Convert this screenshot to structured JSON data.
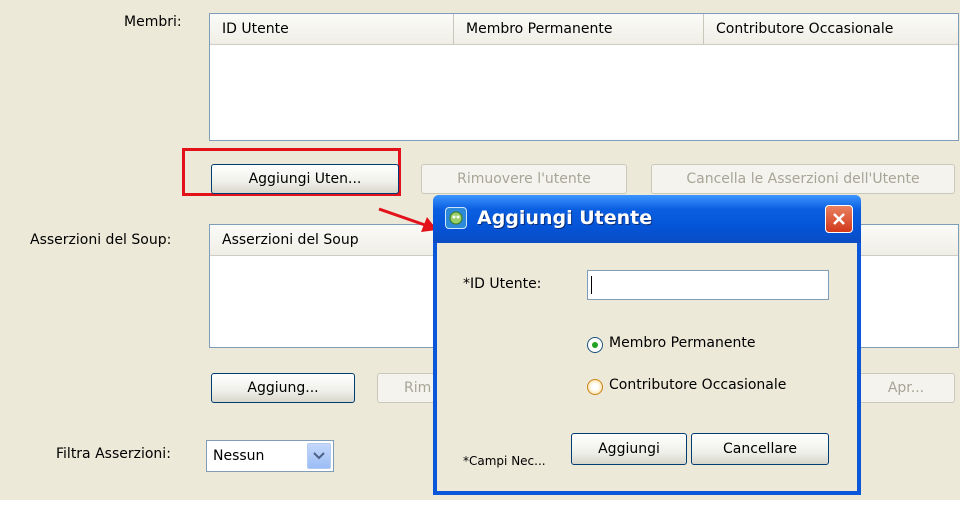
{
  "members": {
    "label": "Membri:",
    "columns": [
      "ID Utente",
      "Membro Permanente",
      "Contributore Occasionale"
    ],
    "rows": []
  },
  "member_buttons": {
    "add": "Aggiungi Uten...",
    "remove": "Rimuovere l'utente",
    "clear_assertions": "Cancella le Asserzioni dell'Utente"
  },
  "assertions": {
    "label": "Asserzioni del Soup:",
    "column": "Asserzioni del Soup",
    "rows": []
  },
  "assertion_buttons": {
    "add": "Aggiung...",
    "remove_partial": "Rim",
    "open": "Apr..."
  },
  "filter": {
    "label": "Filtra Asserzioni:",
    "value": "Nessun"
  },
  "dialog": {
    "title": "Aggiungi Utente",
    "user_id_label": "*ID Utente:",
    "user_id_value": "",
    "options": [
      {
        "label": "Membro Permanente",
        "checked": true
      },
      {
        "label": "Contributore Occasionale",
        "checked": false
      }
    ],
    "required_note": "*Campi Nec...",
    "add_button": "Aggiungi",
    "cancel_button": "Cancellare"
  },
  "colors": {
    "highlight": "#e3111a",
    "dialog_title": "#0a57da",
    "panel_bg": "#ece9d8"
  }
}
